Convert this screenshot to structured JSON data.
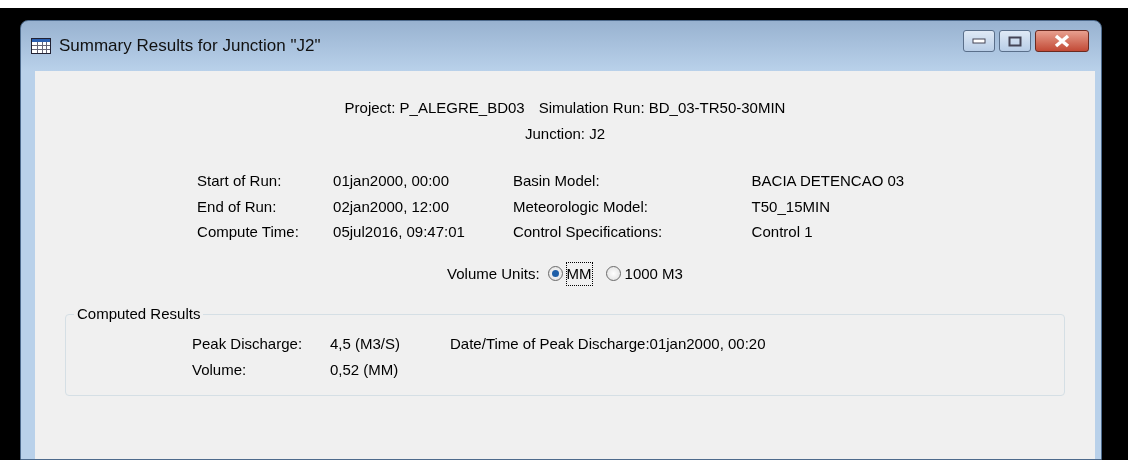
{
  "window": {
    "title": "Summary Results for Junction \"J2\""
  },
  "header": [
    {
      "label": "Project:",
      "value": "P_ALEGRE_BD03"
    },
    {
      "label": "Simulation Run:",
      "value": "BD_03-TR50-30MIN"
    },
    {
      "label": "Junction:",
      "value": "J2"
    }
  ],
  "run_info_left": [
    {
      "label": "Start of Run:",
      "value": "01jan2000, 00:00"
    },
    {
      "label": "End of Run:",
      "value": "02jan2000, 12:00"
    },
    {
      "label": "Compute Time:",
      "value": "05jul2016, 09:47:01"
    }
  ],
  "run_info_right": [
    {
      "label": "Basin Model:",
      "value": "BACIA DETENCAO 03"
    },
    {
      "label": "Meteorologic Model:",
      "value": "T50_15MIN"
    },
    {
      "label": "Control Specifications:",
      "value": "Control 1"
    }
  ],
  "volume_units": {
    "label": "Volume Units:",
    "options": [
      {
        "label": "MM",
        "selected": true
      },
      {
        "label": "1000 M3",
        "selected": false
      }
    ]
  },
  "computed_results": {
    "title": "Computed Results",
    "left": [
      {
        "label": "Peak Discharge:",
        "value": "4,5 (M3/S)"
      },
      {
        "label": "Volume:",
        "value": "0,52 (MM)"
      }
    ],
    "right": [
      {
        "label": "Date/Time of Peak Discharge:",
        "value": "01jan2000, 00:20"
      }
    ]
  }
}
